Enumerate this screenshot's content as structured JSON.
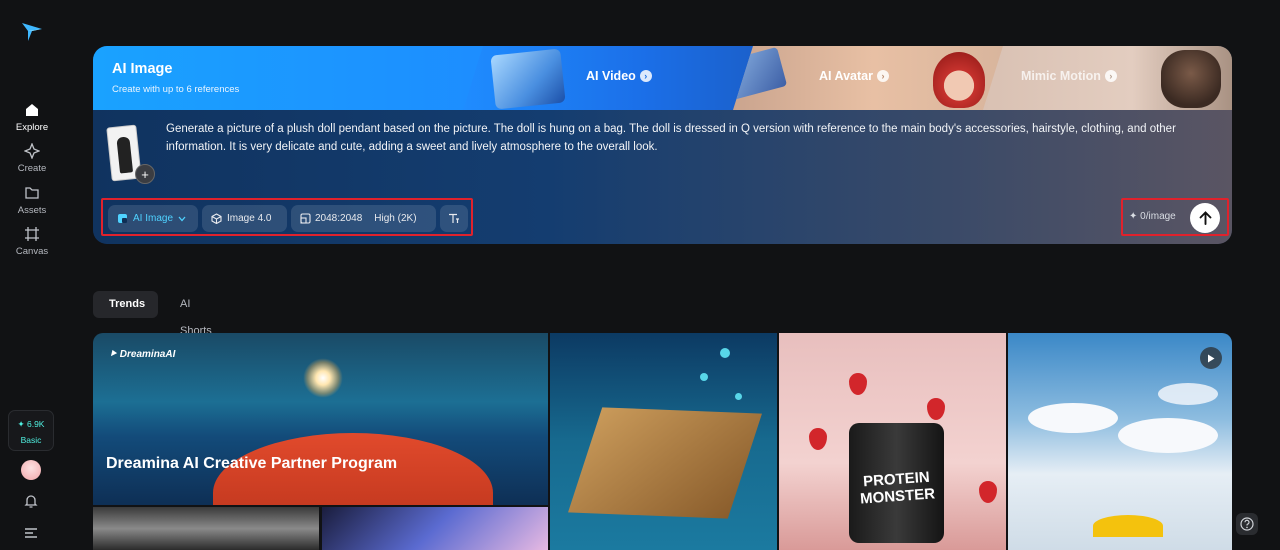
{
  "sidebar": {
    "items": [
      {
        "label": "Explore",
        "icon": "home-icon"
      },
      {
        "label": "Create",
        "icon": "sparkle-icon"
      },
      {
        "label": "Assets",
        "icon": "folder-icon"
      },
      {
        "label": "Canvas",
        "icon": "canvas-icon"
      }
    ],
    "credits": {
      "amount": "✦ 6.9K",
      "plan": "Basic"
    }
  },
  "hero": {
    "title": "AI Image",
    "subtitle": "Create with up to 6 references",
    "tabs": [
      {
        "label": "AI Video"
      },
      {
        "label": "AI Avatar"
      },
      {
        "label": "Mimic Motion"
      }
    ],
    "prompt": "Generate a picture of a plush doll pendant based on the picture. The doll is hung on a bag. The doll is dressed in Q version with reference to the main body's accessories, hairstyle, clothing, and other information. It is very delicate and cute, adding a sweet and lively atmosphere to the overall look.",
    "toolbar": {
      "mode": "AI Image",
      "model": "Image 4.0",
      "ratio": "2048:2048",
      "quality": "High (2K)"
    },
    "cost": "0/image"
  },
  "content_tabs": [
    {
      "label": "Trends"
    },
    {
      "label": "AI Shorts"
    }
  ],
  "gallery": {
    "brand": "DreaminaAI",
    "featured_title": "Dreamina AI Creative Partner Program",
    "protein_label": "PROTEIN MONSTER"
  },
  "colors": {
    "accent": "#4ff0e0",
    "highlight_border": "#e0222c",
    "hero_blue": "#1aa2ff"
  }
}
